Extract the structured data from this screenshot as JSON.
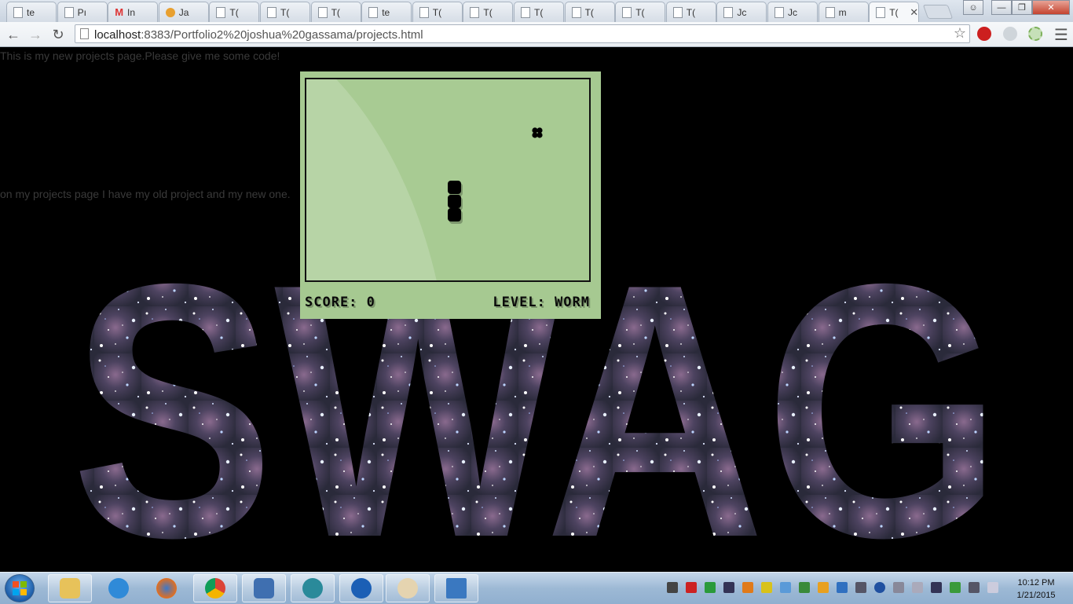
{
  "browser": {
    "tabs": [
      {
        "label": "te",
        "icon": "page-icon"
      },
      {
        "label": "Pı",
        "icon": "page-icon"
      },
      {
        "label": "In",
        "icon": "gmail-icon"
      },
      {
        "label": "Ja",
        "icon": "people-icon"
      },
      {
        "label": "T(",
        "icon": "page-icon"
      },
      {
        "label": "T(",
        "icon": "page-icon"
      },
      {
        "label": "T(",
        "icon": "page-icon"
      },
      {
        "label": "te",
        "icon": "page-icon"
      },
      {
        "label": "T(",
        "icon": "page-icon"
      },
      {
        "label": "T(",
        "icon": "page-icon"
      },
      {
        "label": "T(",
        "icon": "page-icon"
      },
      {
        "label": "T(",
        "icon": "page-icon"
      },
      {
        "label": "T(",
        "icon": "page-icon"
      },
      {
        "label": "T(",
        "icon": "page-icon"
      },
      {
        "label": "Jc",
        "icon": "page-icon"
      },
      {
        "label": "Jc",
        "icon": "page-icon"
      },
      {
        "label": "m",
        "icon": "page-icon"
      },
      {
        "label": "T(",
        "icon": "page-icon",
        "active": true
      }
    ],
    "tab_close_glyph": "✕",
    "address_host": "localhost",
    "address_rest": ":8383/Portfolio2%20joshua%20gassama/projects.html"
  },
  "page": {
    "intro_text": "This is my new projects page.Please give me some code!",
    "second_text": "on my projects page I have my old project and my new one.",
    "background_word": "SWAG"
  },
  "game": {
    "score_text": "SCORE: 0",
    "level_text": "LEVEL: WORM",
    "colors": {
      "screen": "#a8cb93",
      "frame": "#a6c991",
      "ink": "#000000"
    }
  },
  "taskbar": {
    "pinned": [
      "file-explorer-icon",
      "internet-explorer-icon",
      "firefox-icon",
      "chrome-icon",
      "virtualbox-icon",
      "app-icon",
      "network-app-icon",
      "paint-icon",
      "photo-viewer-icon"
    ],
    "clock_time": "10:12 PM",
    "clock_date": "1/21/2015"
  }
}
